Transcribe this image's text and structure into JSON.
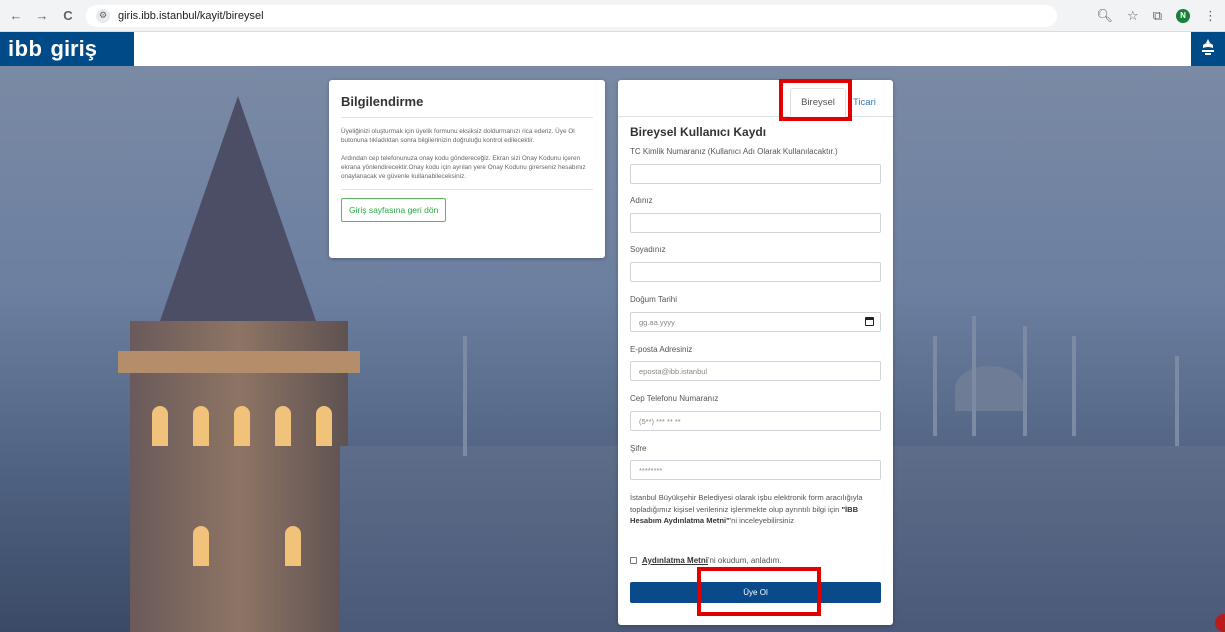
{
  "browser": {
    "back": "←",
    "forward": "→",
    "reload": "C",
    "url": "giris.ibb.istanbul/kayit/bireysel",
    "profile_initial": "N",
    "menu": "⋮"
  },
  "header": {
    "logo_left": "ibb",
    "logo_right": "giriş"
  },
  "info": {
    "title": "Bilgilendirme",
    "paragraph1": "Üyeliğinizi oluşturmak için üyelik formunu eksiksiz doldurmanızı rica ederiz. Üye Ol butonuna tıkladıktan sonra bilgilerinizin doğruluğu kontrol edilecektir.",
    "paragraph2": "Ardından cep telefonunuza onay kodu göndereceğiz. Ekran sizi Onay Kodunu içeren ekrana yönlendirecektir.Onay kodu için ayrılan yere Onay Kodunu girerseniz hesabınız onaylanacak ve güvenle kullanabileceksiniz.",
    "back_button": "Giriş sayfasına geri dön"
  },
  "form": {
    "tabs": [
      "Bireysel",
      "Ticari"
    ],
    "active_tab": "Bireysel",
    "title": "Bireysel Kullanıcı Kaydı",
    "fields": [
      {
        "label": "TC Kimlik Numaranız (Kullanıcı Adı Olarak Kullanılacaktır.)",
        "placeholder": ""
      },
      {
        "label": "Adınız",
        "placeholder": ""
      },
      {
        "label": "Soyadınız",
        "placeholder": ""
      },
      {
        "label": "Doğum Tarihi",
        "placeholder": "gg.aa.yyyy"
      },
      {
        "label": "E-posta Adresiniz",
        "placeholder": "eposta@ibb.istanbul"
      },
      {
        "label": "Cep Telefonu Numaranız",
        "placeholder": "(5**) *** ** **"
      },
      {
        "label": "Şifre",
        "placeholder": "********"
      }
    ],
    "consent_text_before": "İstanbul Büyükşehir Belediyesi olarak işbu elektronik form aracılığıyla topladığımız kişisel verileriniz işlenmekte olup ayrıntılı bilgi için ",
    "consent_link": "\"İBB Hesabım Aydınlatma Metni\"",
    "consent_text_after": "'ni inceleyebilirsiniz",
    "checkbox_link": "Aydınlatma Metni",
    "checkbox_text": "'ni okudum, anladım.",
    "submit": "Üye Ol"
  },
  "colors": {
    "brand": "#004b87",
    "submit": "#0a4a8a",
    "highlight": "#e00000",
    "back_button": "#28a745"
  }
}
